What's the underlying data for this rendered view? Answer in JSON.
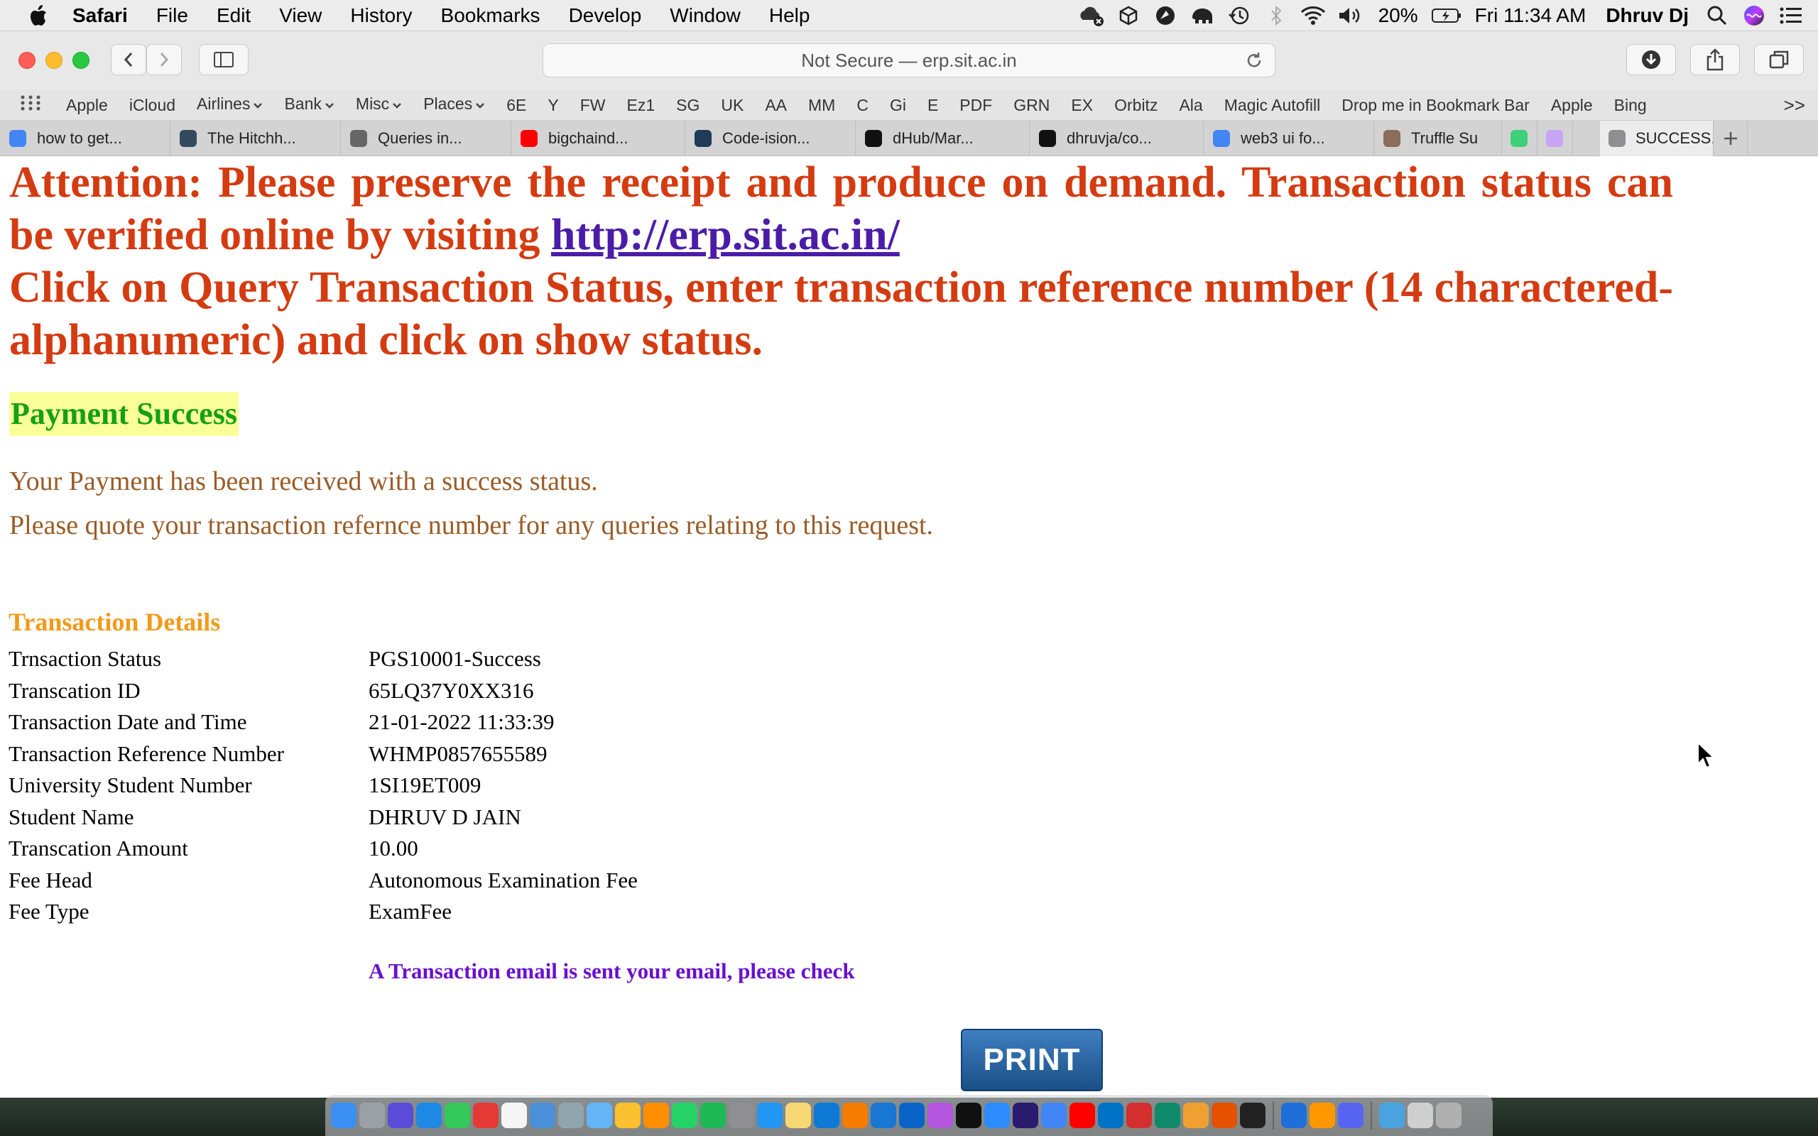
{
  "menubar": {
    "app_name": "Safari",
    "menus": [
      "File",
      "Edit",
      "View",
      "History",
      "Bookmarks",
      "Develop",
      "Window",
      "Help"
    ],
    "battery": "20%",
    "clock": "Fri 11:34 AM",
    "user": "Dhruv Dj"
  },
  "toolbar": {
    "address": "Not Secure — erp.sit.ac.in"
  },
  "favorites": {
    "items": [
      {
        "label": "Apple",
        "menu": false
      },
      {
        "label": "iCloud",
        "menu": false
      },
      {
        "label": "Airlines",
        "menu": true
      },
      {
        "label": "Bank",
        "menu": true
      },
      {
        "label": "Misc",
        "menu": true
      },
      {
        "label": "Places",
        "menu": true
      },
      {
        "label": "6E",
        "menu": false
      },
      {
        "label": "Y",
        "menu": false
      },
      {
        "label": "FW",
        "menu": false
      },
      {
        "label": "Ez1",
        "menu": false
      },
      {
        "label": "SG",
        "menu": false
      },
      {
        "label": "UK",
        "menu": false
      },
      {
        "label": "AA",
        "menu": false
      },
      {
        "label": "MM",
        "menu": false
      },
      {
        "label": "C",
        "menu": false
      },
      {
        "label": "Gi",
        "menu": false
      },
      {
        "label": "E",
        "menu": false
      },
      {
        "label": "PDF",
        "menu": false
      },
      {
        "label": "GRN",
        "menu": false
      },
      {
        "label": "EX",
        "menu": false
      },
      {
        "label": "Orbitz",
        "menu": false
      },
      {
        "label": "Ala",
        "menu": false
      },
      {
        "label": "Magic Autofill",
        "menu": false
      },
      {
        "label": "Drop me in Bookmark Bar",
        "menu": false
      },
      {
        "label": "Apple",
        "menu": false
      },
      {
        "label": "Bing",
        "menu": false
      }
    ],
    "overflow": ">>"
  },
  "tabs": [
    {
      "label": "how to get...",
      "icon": "google-icon"
    },
    {
      "label": "The Hitchh...",
      "icon": "hitchhiker-icon"
    },
    {
      "label": "Queries in...",
      "icon": "document-icon"
    },
    {
      "label": "bigchaind...",
      "icon": "youtube-icon"
    },
    {
      "label": "Code-ision...",
      "icon": "d-icon"
    },
    {
      "label": "dHub/Mar...",
      "icon": "github-icon"
    },
    {
      "label": "dhruvja/co...",
      "icon": "github-icon"
    },
    {
      "label": "web3 ui fo...",
      "icon": "google-icon"
    },
    {
      "label": "Truffle Su",
      "icon": "truffle-icon"
    },
    {
      "label": "",
      "icon": "green-icon"
    },
    {
      "label": "",
      "icon": "purple-icon"
    },
    {
      "label": "SUCCESS...",
      "icon": "s-icon",
      "active": true
    }
  ],
  "page": {
    "attention_text": "Attention: Please preserve the receipt and produce on demand. Transaction status can be verified online by visiting",
    "attention_link": "http://erp.sit.ac.in/",
    "attention_text2": "Click on Query Transaction Status, enter transaction reference number (14 charactered-alphanumeric) and click on show status.",
    "success_title": "Payment Success",
    "message1": "Your Payment has been received with a success status.",
    "message2": "Please quote your transaction refernce number for any queries relating to this request.",
    "details_title": "Transaction Details",
    "details": [
      {
        "label": "Trnsaction Status",
        "value": "PGS10001-Success"
      },
      {
        "label": "Transcation ID",
        "value": "65LQ37Y0XX316"
      },
      {
        "label": "Transaction Date and Time",
        "value": "21-01-2022 11:33:39"
      },
      {
        "label": "Transaction Reference Number",
        "value": "WHMP0857655589"
      },
      {
        "label": "University Student Number",
        "value": "1SI19ET009"
      },
      {
        "label": "Student Name",
        "value": "DHRUV D JAIN"
      },
      {
        "label": "Transcation Amount",
        "value": "10.00"
      },
      {
        "label": "Fee Head",
        "value": "Autonomous Examination Fee"
      },
      {
        "label": "Fee Type",
        "value": "ExamFee"
      }
    ],
    "email_note": "A Transaction email is sent your email, please check",
    "print_label": "PRINT"
  },
  "colors": {
    "attention": "#d43b11",
    "link": "#4b1ca8",
    "success_text": "#14a014",
    "success_bg": "#faff9a",
    "message": "#9a5b26",
    "details_title": "#f29a1a",
    "email_note": "#6a0fcf",
    "print_button": "#1f5a96"
  },
  "dock": {
    "icons": [
      "finder",
      "launchpad",
      "siri",
      "safari",
      "facetime",
      "opera",
      "calendar",
      "preview",
      "scanner",
      "mail",
      "photos",
      "sublime",
      "whatsapp",
      "spotify",
      "system-preferences",
      "app-store",
      "notes",
      "vscode",
      "books",
      "xcode",
      "onedrive",
      "podcasts",
      "apple-tv",
      "zoom",
      "amazon-music",
      "chrome",
      "youtube",
      "outlook",
      "acrobat",
      "cleaner",
      "sequel",
      "toolbox",
      "terminal",
      "safari-tech",
      "sublime-text",
      "discord",
      "downloads",
      "help",
      "trash"
    ]
  }
}
